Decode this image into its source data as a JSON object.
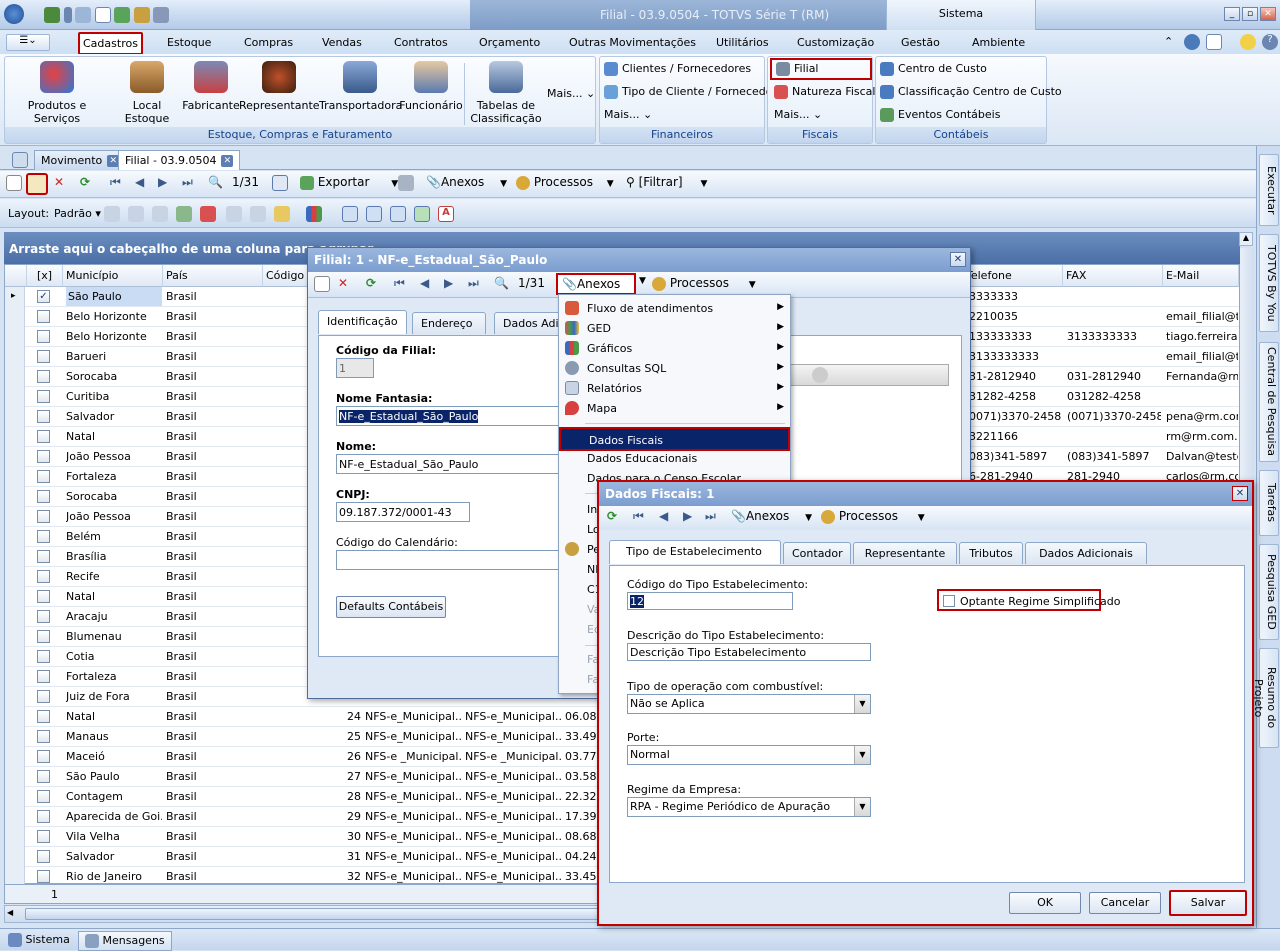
{
  "window": {
    "title": "Filial - 03.9.0504 - TOTVS Série T (RM)",
    "system_tab": "Sistema"
  },
  "menubar": {
    "tabs": [
      "Cadastros",
      "Estoque",
      "Compras",
      "Vendas",
      "Contratos",
      "Orçamento",
      "Outras Movimentações",
      "Utilitários",
      "Customização",
      "Gestão",
      "Ambiente"
    ],
    "selected": "Cadastros"
  },
  "ribbon": {
    "group1": {
      "label": "Estoque, Compras e Faturamento",
      "buttons": [
        "Produtos e Serviços",
        "Local Estoque",
        "Fabricante",
        "Representante",
        "Transportadora",
        "Funcionário"
      ],
      "tabelas_line1": "Tabelas de",
      "tabelas_line2": "Classificação ⌄",
      "mais": "Mais... ⌄"
    },
    "financeiros": {
      "label": "Financeiros",
      "items": [
        "Clientes / Fornecedores",
        "Tipo de Cliente / Fornecedor"
      ],
      "mais": "Mais... ⌄"
    },
    "fiscais": {
      "label": "Fiscais",
      "items": [
        "Filial",
        "Natureza Fiscal"
      ],
      "mais": "Mais... ⌄"
    },
    "contabeis": {
      "label": "Contábeis",
      "items": [
        "Centro de Custo",
        "Classificação Centro de Custo",
        "Eventos Contábeis"
      ]
    }
  },
  "doctabs": [
    "Movimento",
    "Filial - 03.9.0504"
  ],
  "toolbar": {
    "record_count": "1/31",
    "exportar": "Exportar",
    "anexos": "Anexos",
    "processos": "Processos",
    "filtrar": "[Filtrar]"
  },
  "layoutbar": {
    "label": "Layout:",
    "value": "Padrão"
  },
  "grid": {
    "group_hint": "Arraste aqui o cabeçalho de uma coluna para agrupar",
    "columns": [
      "[x]",
      "Município",
      "País",
      "Código do",
      "Telefone",
      "FAX",
      "E-Mail"
    ],
    "rows": [
      {
        "mun": "São Paulo",
        "pais": "Brasil",
        "tel": "3333333",
        "fax": "",
        "email": ""
      },
      {
        "mun": "Belo Horizonte",
        "pais": "Brasil",
        "tel": "2210035",
        "fax": "",
        "email": "email_filial@tes"
      },
      {
        "mun": "Belo Horizonte",
        "pais": "Brasil",
        "tel": "133333333",
        "fax": "3133333333",
        "email": "tiago.ferreira@"
      },
      {
        "mun": "Barueri",
        "pais": "Brasil",
        "tel": "3133333333",
        "fax": "",
        "email": "email_filial@tes"
      },
      {
        "mun": "Sorocaba",
        "pais": "Brasil",
        "tel": "31-2812940",
        "fax": "031-2812940",
        "email": "Fernanda@rm."
      },
      {
        "mun": "Curitiba",
        "pais": "Brasil",
        "tel": "31282-4258",
        "fax": "031282-4258",
        "email": ""
      },
      {
        "mun": "Salvador",
        "pais": "Brasil",
        "tel": "0071)3370-2458",
        "fax": "(0071)3370-2458",
        "email": "pena@rm.com."
      },
      {
        "mun": "Natal",
        "pais": "Brasil",
        "tel": "3221166",
        "fax": "",
        "email": "rm@rm.com.br"
      },
      {
        "mun": "João Pessoa",
        "pais": "Brasil",
        "tel": "083)341-5897",
        "fax": "(083)341-5897",
        "email": "Dalvan@teste."
      },
      {
        "mun": "Fortaleza",
        "pais": "Brasil",
        "tel": "6-281-2940",
        "fax": "281-2940",
        "email": "carlos@rm.com.b"
      },
      {
        "mun": "Sorocaba",
        "pais": "Brasil",
        "tel": "",
        "fax": "",
        "email": ""
      },
      {
        "mun": "João Pessoa",
        "pais": "Brasil",
        "tel": "",
        "fax": "",
        "email": ""
      },
      {
        "mun": "Belém",
        "pais": "Brasil",
        "tel": "",
        "fax": "",
        "email": ""
      },
      {
        "mun": "Brasília",
        "pais": "Brasil",
        "tel": "",
        "fax": "",
        "email": ""
      },
      {
        "mun": "Recife",
        "pais": "Brasil",
        "tel": "",
        "fax": "",
        "email": ""
      },
      {
        "mun": "Natal",
        "pais": "Brasil",
        "tel": "",
        "fax": "",
        "email": ""
      },
      {
        "mun": "Aracaju",
        "pais": "Brasil",
        "tel": "",
        "fax": "",
        "email": ""
      },
      {
        "mun": "Blumenau",
        "pais": "Brasil",
        "tel": "",
        "fax": "",
        "email": ""
      },
      {
        "mun": "Cotia",
        "pais": "Brasil",
        "tel": "",
        "fax": "",
        "email": ""
      },
      {
        "mun": "Fortaleza",
        "pais": "Brasil",
        "tel": "",
        "fax": "",
        "email": ""
      },
      {
        "mun": "Juiz de Fora",
        "pais": "Brasil",
        "tel": "",
        "fax": "",
        "email": ""
      },
      {
        "mun": "Natal",
        "pais": "Brasil",
        "num": "24",
        "c1": "NFS-e_Municipal...",
        "c2": "NFS-e_Municipal...",
        "c3": "06.08"
      },
      {
        "mun": "Manaus",
        "pais": "Brasil",
        "num": "25",
        "c1": "NFS-e_Municipal...",
        "c2": "NFS-e_Municipal...",
        "c3": "33.49"
      },
      {
        "mun": "Maceió",
        "pais": "Brasil",
        "num": "26",
        "c1": "NFS-e _Municipal...",
        "c2": "NFS-e _Municipal...",
        "c3": "03.77"
      },
      {
        "mun": "São Paulo",
        "pais": "Brasil",
        "num": "27",
        "c1": "NFS-e_Municipal...",
        "c2": "NFS-e_Municipal...",
        "c3": "03.58"
      },
      {
        "mun": "Contagem",
        "pais": "Brasil",
        "num": "28",
        "c1": "NFS-e_Municipal...",
        "c2": "NFS-e_Municipal...",
        "c3": "22.32"
      },
      {
        "mun": "Aparecida de Goi...",
        "pais": "Brasil",
        "num": "29",
        "c1": "NFS-e_Municipal...",
        "c2": "NFS-e_Municipal...",
        "c3": "17.39"
      },
      {
        "mun": "Vila Velha",
        "pais": "Brasil",
        "num": "30",
        "c1": "NFS-e_Municipal...",
        "c2": "NFS-e_Municipal...",
        "c3": "08.68"
      },
      {
        "mun": "Salvador",
        "pais": "Brasil",
        "num": "31",
        "c1": "NFS-e_Municipal...",
        "c2": "NFS-e_Municipal...",
        "c3": "04.24"
      },
      {
        "mun": "Rio de Janeiro",
        "pais": "Brasil",
        "num": "32",
        "c1": "NFS-e_Municipal...",
        "c2": "NFS-e_Municipal...",
        "c3": "33.45"
      }
    ],
    "footer_count": "1"
  },
  "filial_dialog": {
    "title": "Filial: 1 - NF-e_Estadual_São_Paulo",
    "record_count": "1/31",
    "anexos": "Anexos",
    "processos": "Processos",
    "tabs": [
      "Identificação",
      "Endereço",
      "Dados Adic"
    ],
    "codigo_label": "Código da Filial:",
    "codigo_value": "1",
    "fantasia_label": "Nome Fantasia:",
    "fantasia_value": "NF-e_Estadual_São_Paulo",
    "nome_label": "Nome:",
    "nome_value": "NF-e_Estadual_São_Paulo",
    "cnpj_label": "CNPJ:",
    "cnpj_value": "09.187.372/0001-43",
    "calendario_label": "Código do Calendário:",
    "calendario_value": "",
    "defaults_button": "Defaults Contábeis"
  },
  "anexos_menu": {
    "items": [
      "Fluxo de atendimentos",
      "GED",
      "Gráficos",
      "Consultas SQL",
      "Relatórios",
      "Mapa"
    ],
    "highlighted": "Dados Fiscais",
    "after": [
      "Dados Educacionais",
      "Dados para o Censo Escolar"
    ],
    "partial": [
      "In",
      "Lo",
      "Pe",
      "NF",
      "C1",
      "Va",
      "Ed",
      "Fa",
      "Fa"
    ]
  },
  "fiscais_dialog": {
    "title": "Dados Fiscais: 1",
    "anexos": "Anexos",
    "processos": "Processos",
    "tabs": [
      "Tipo de Estabelecimento",
      "Contador",
      "Representante",
      "Tributos",
      "Dados Adicionais"
    ],
    "codigo_label": "Código do Tipo Estabelecimento:",
    "codigo_value": "12",
    "optante_label": "Optante Regime Simplificado",
    "descricao_label": "Descrição do Tipo Estabelecimento:",
    "descricao_value": "Descrição Tipo Estabelecimento",
    "combustivel_label": "Tipo de operação com combustível:",
    "combustivel_value": "Não se Aplica",
    "porte_label": "Porte:",
    "porte_value": "Normal",
    "regime_label": "Regime da Empresa:",
    "regime_value": "RPA - Regime Periódico de Apuração",
    "ok": "OK",
    "cancelar": "Cancelar",
    "salvar": "Salvar"
  },
  "rightbar": [
    "Executar",
    "TOTVS By You",
    "Central de Pesquisa",
    "Tarefas",
    "Pesquisa GED",
    "Resumo do Projeto"
  ],
  "statusbar": {
    "sistema": "Sistema",
    "mensagens": "Mensagens"
  },
  "colors": {
    "accent": "#c00000",
    "selection": "#0a246a",
    "title_blue": "#15428b"
  }
}
